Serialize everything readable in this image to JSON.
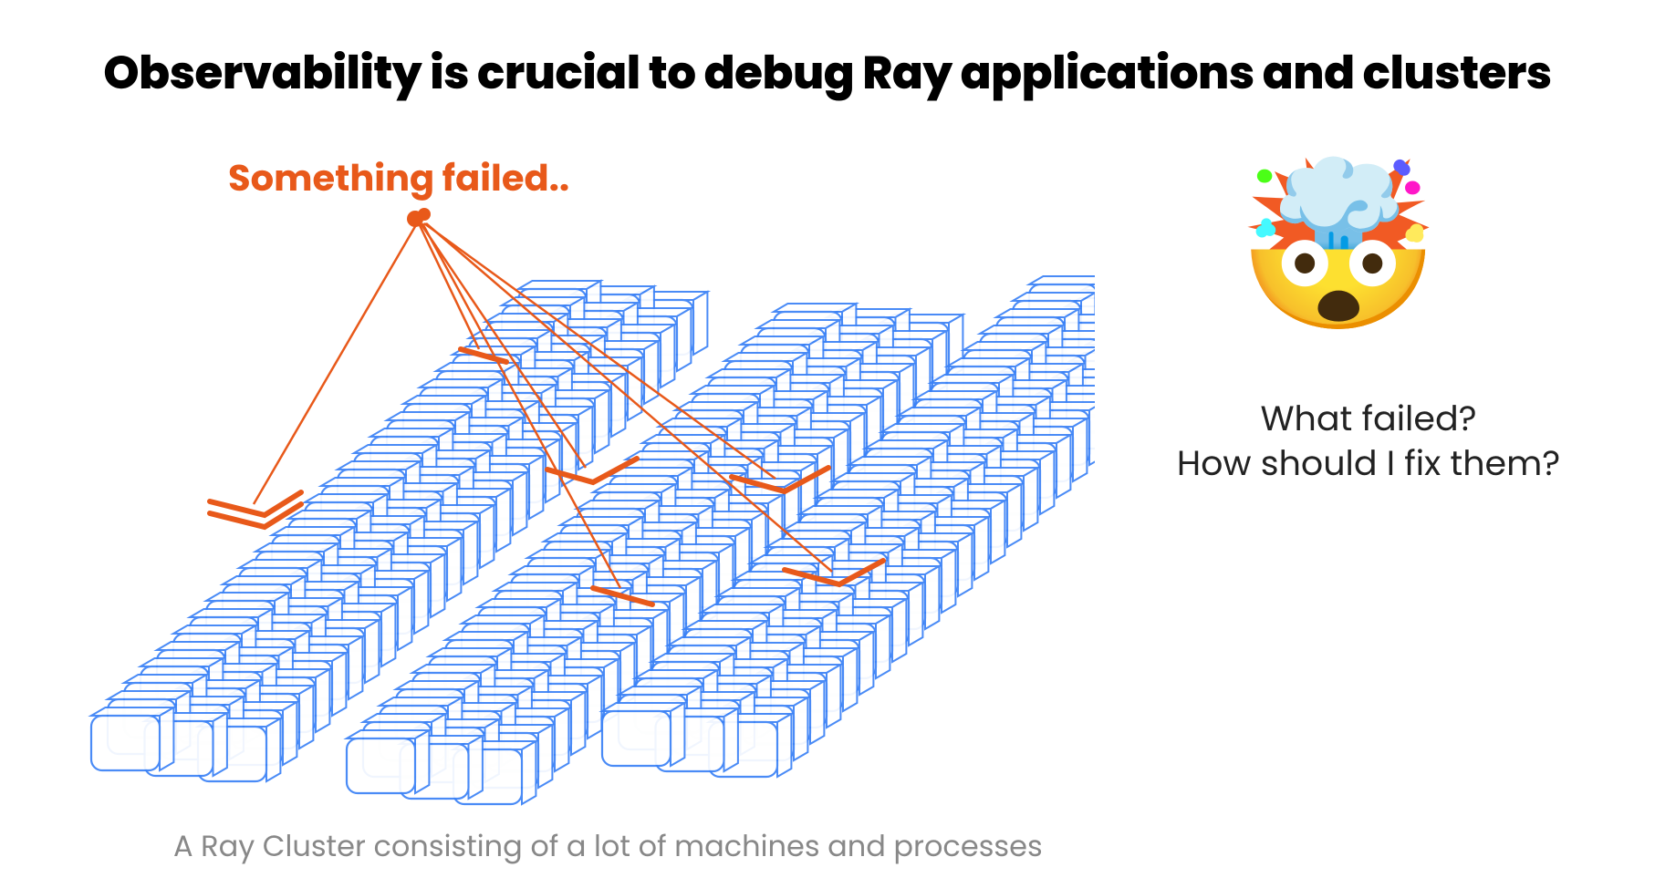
{
  "title": "Observability is crucial to debug Ray applications and clusters",
  "failed_label": "Something failed..",
  "caption": "A Ray Cluster consisting of a lot of machines and processes",
  "questions": {
    "line1": "What failed?",
    "line2": "How should I fix them?"
  },
  "emoji": "🤯",
  "colors": {
    "accent_orange": "#e8591a",
    "cluster_blue_stroke": "#3b82f6",
    "cluster_blue_fill": "#ffffff",
    "caption_gray": "#888888"
  },
  "diagram": {
    "description": "Three isometric stacks of rounded-rectangle machine/process boxes representing a Ray cluster. A few boxes highlighted in orange indicate failures, with orange lines converging to a point at the top labeled 'Something failed..'",
    "stacks": 3,
    "boxes_per_stack_estimate": 30
  }
}
